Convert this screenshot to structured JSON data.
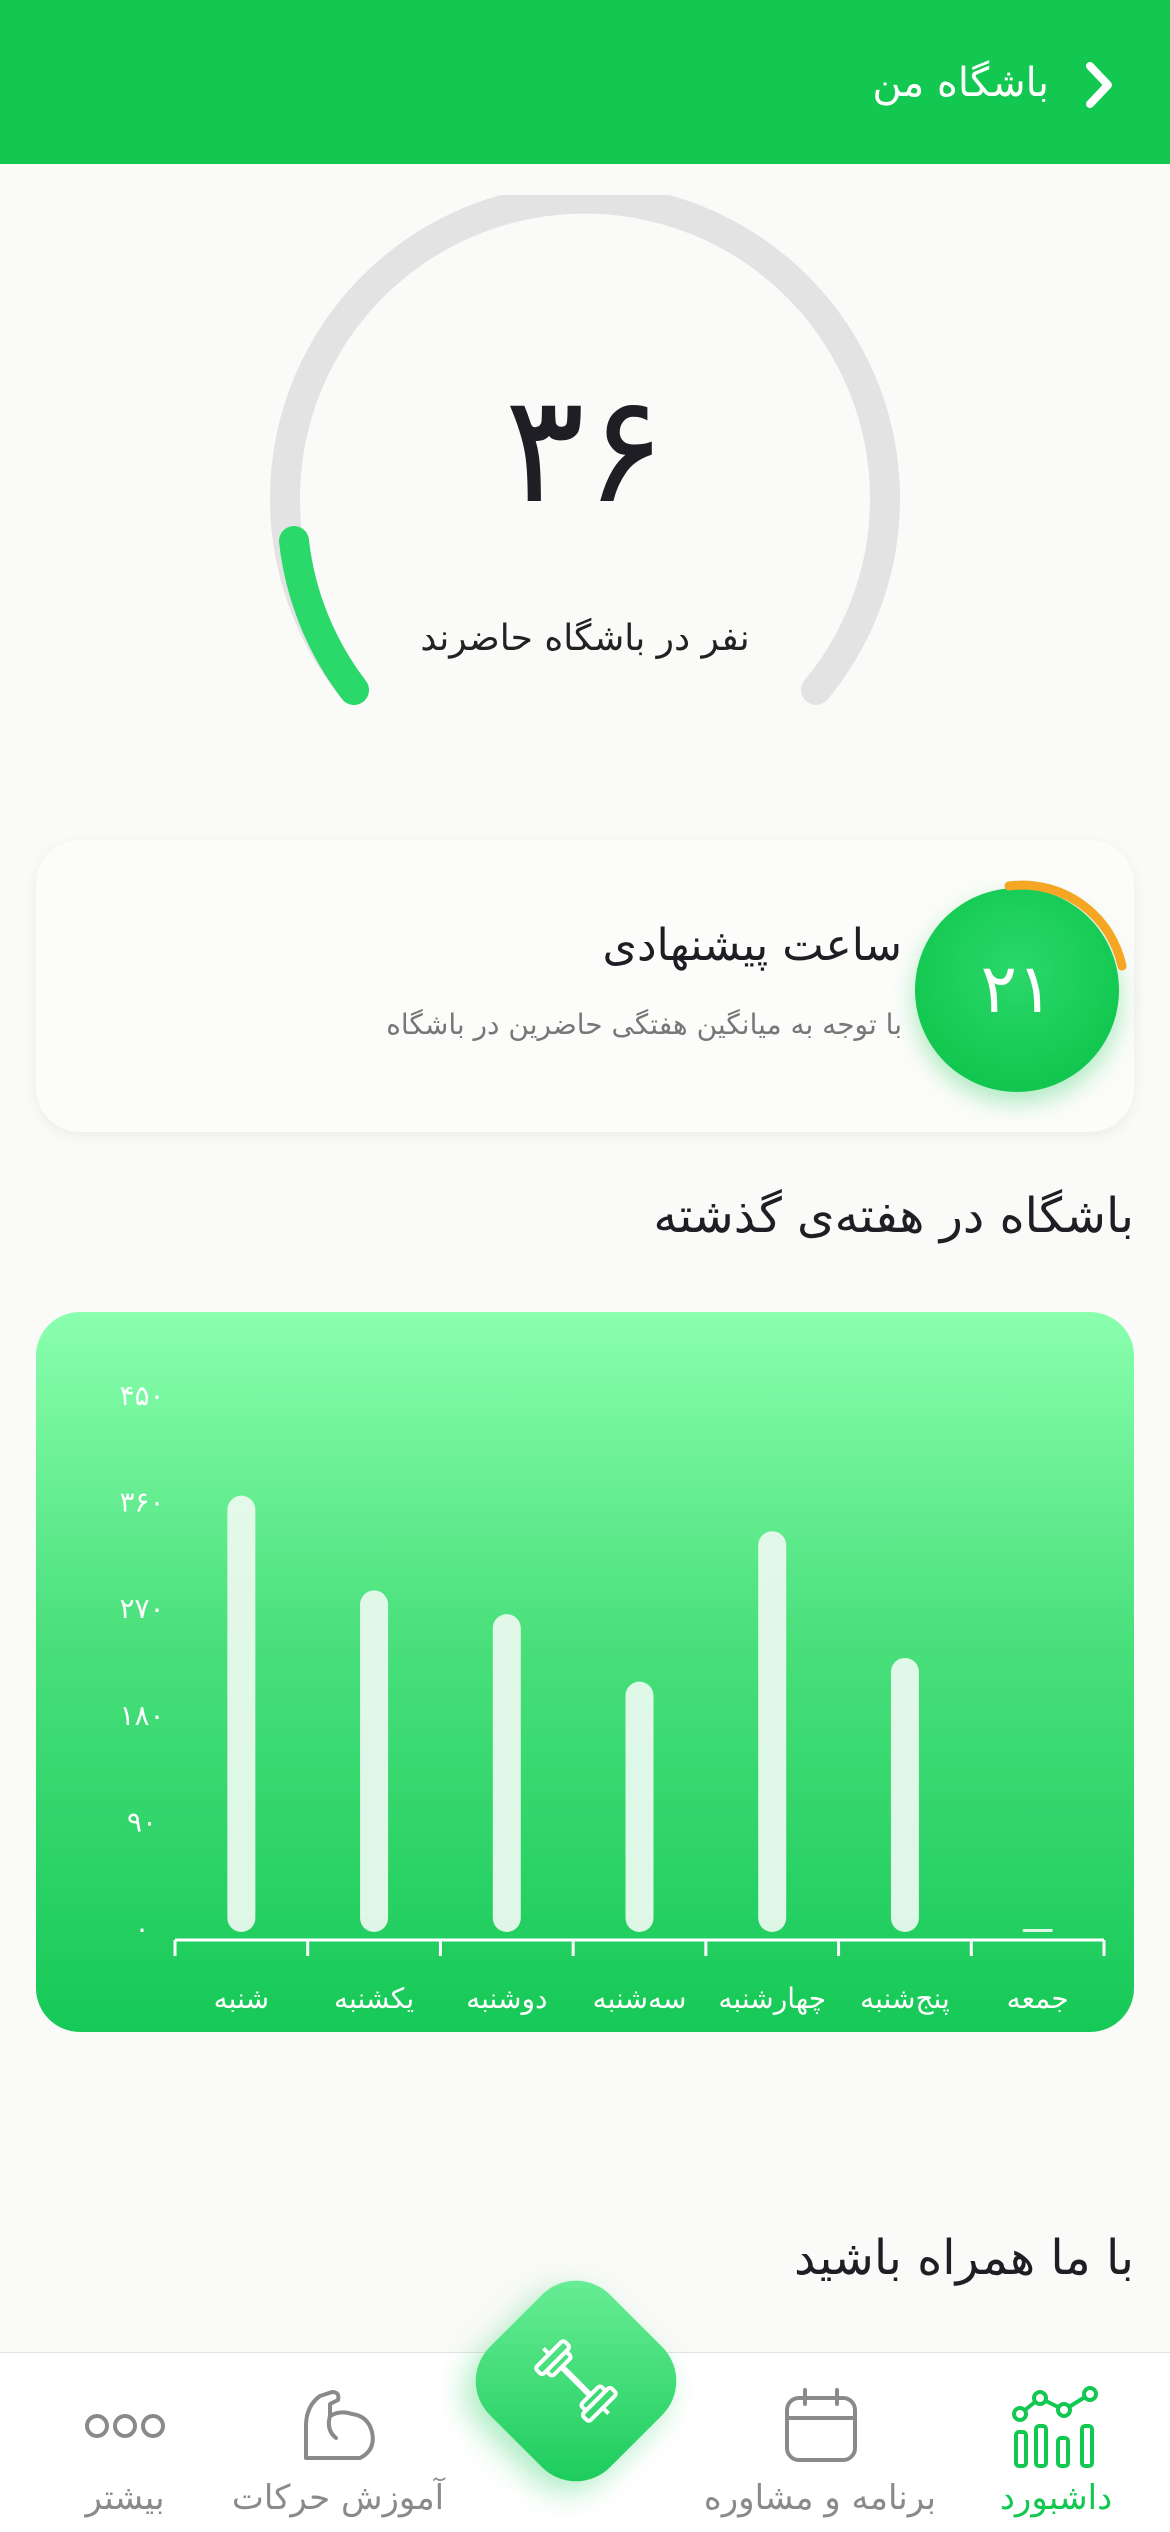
{
  "header": {
    "title": "باشگاه من",
    "bg_color": "#12c850",
    "back_icon": "chevron-right-icon"
  },
  "occupancy": {
    "count": "۳۶",
    "caption": "نفر در باشگاه حاضرند",
    "level": 0.1,
    "track_color": "#e3e3e3",
    "fill_color": "#2bd86a"
  },
  "recommended": {
    "hour": "۲۱",
    "title": "ساعت پیشنهادی",
    "subtitle": "با توجه به میانگین هفتگی حاضرین در باشگاه",
    "ring_color": "#f5a623"
  },
  "weekly": {
    "section_title": "باشگاه در هفته‌ی گذشته"
  },
  "chart_data": {
    "type": "bar",
    "title": "",
    "xlabel": "",
    "ylabel": "",
    "ylim": [
      0,
      450
    ],
    "yticks": [
      "۰",
      "۹۰",
      "۱۸۰",
      "۲۷۰",
      "۳۶۰",
      "۴۵۰"
    ],
    "ytick_values": [
      0,
      90,
      180,
      270,
      360,
      450
    ],
    "categories": [
      "شنبه",
      "یکشنبه",
      "دوشنبه",
      "سه‌شنبه",
      "چهارشنبه",
      "پنج‌شنبه",
      "جمعه"
    ],
    "values": [
      365,
      285,
      265,
      208,
      335,
      228,
      0
    ],
    "grid": false,
    "bar_color": "#eefaf1"
  },
  "footer_section": {
    "title": "با ما همراه باشید"
  },
  "tabbar": {
    "tabs": [
      {
        "label": "داشبورد",
        "icon": "dashboard-chart-icon",
        "active": true
      },
      {
        "label": "برنامه و مشاوره",
        "icon": "calendar-icon",
        "active": false
      },
      {
        "label": "آموزش حرکات",
        "icon": "muscle-arm-icon",
        "active": false
      },
      {
        "label": "بیشتر",
        "icon": "more-dots-icon",
        "active": false
      }
    ],
    "center_icon": "dumbbell-icon",
    "active_color": "#12c850",
    "inactive_color": "#8a8a8a"
  }
}
